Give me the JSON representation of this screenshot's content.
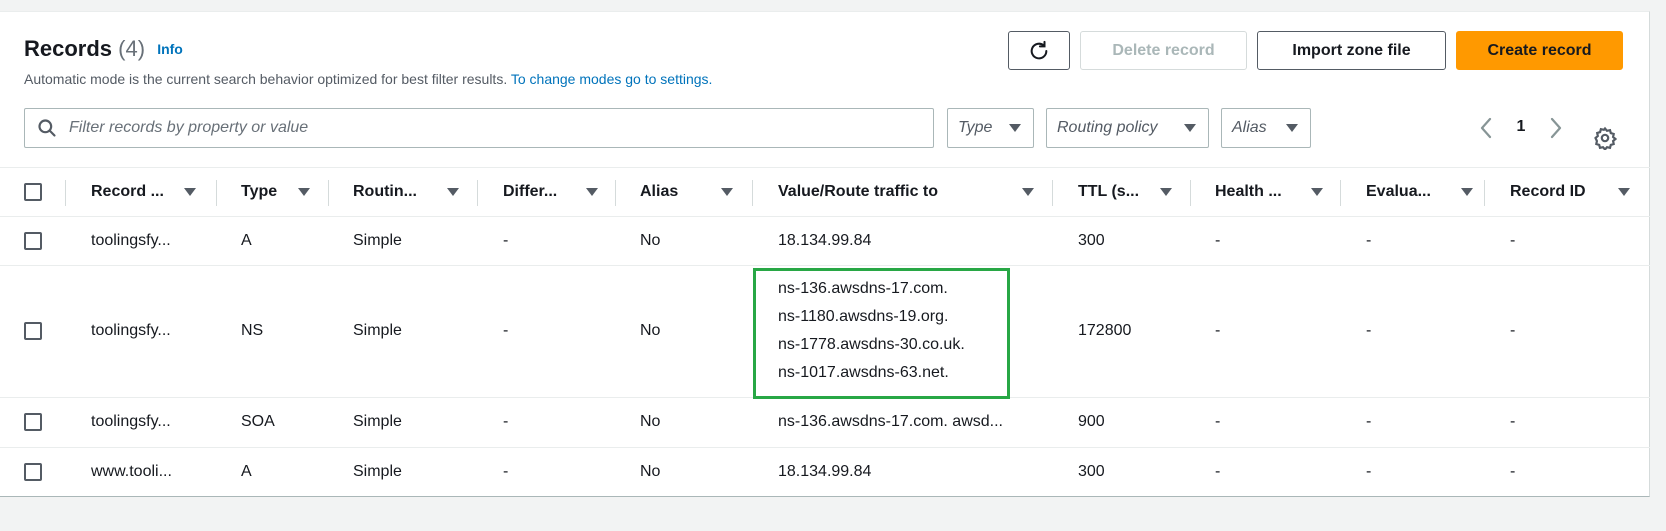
{
  "header": {
    "title": "Records",
    "count": "(4)",
    "info_label": "Info",
    "description": "Automatic mode is the current search behavior optimized for best filter results.",
    "description_link": "To change modes go to settings."
  },
  "toolbar": {
    "refresh_icon": "refresh-icon",
    "delete_label": "Delete record",
    "import_label": "Import zone file",
    "create_label": "Create record"
  },
  "search": {
    "placeholder": "Filter records by property or value",
    "value": ""
  },
  "filters": {
    "type": "Type",
    "routing": "Routing policy",
    "alias": "Alias"
  },
  "pagination": {
    "current_page": "1"
  },
  "table": {
    "columns": [
      "Record ...",
      "Type",
      "Routin...",
      "Differ...",
      "Alias",
      "Value/Route traffic to",
      "TTL (s...",
      "Health ...",
      "Evalua...",
      "Record ID"
    ],
    "rows": [
      {
        "name": "toolingsfy...",
        "type": "A",
        "routing": "Simple",
        "differ": "-",
        "alias": "No",
        "value": [
          "18.134.99.84"
        ],
        "ttl": "300",
        "health": "-",
        "evaluate": "-",
        "record_id": "-"
      },
      {
        "name": "toolingsfy...",
        "type": "NS",
        "routing": "Simple",
        "differ": "-",
        "alias": "No",
        "value": [
          "ns-136.awsdns-17.com.",
          "ns-1180.awsdns-19.org.",
          "ns-1778.awsdns-30.co.uk.",
          "ns-1017.awsdns-63.net."
        ],
        "ttl": "172800",
        "health": "-",
        "evaluate": "-",
        "record_id": "-"
      },
      {
        "name": "toolingsfy...",
        "type": "SOA",
        "routing": "Simple",
        "differ": "-",
        "alias": "No",
        "value": [
          "ns-136.awsdns-17.com. awsd..."
        ],
        "ttl": "900",
        "health": "-",
        "evaluate": "-",
        "record_id": "-"
      },
      {
        "name": "www.tooli...",
        "type": "A",
        "routing": "Simple",
        "differ": "-",
        "alias": "No",
        "value": [
          "18.134.99.84"
        ],
        "ttl": "300",
        "health": "-",
        "evaluate": "-",
        "record_id": "-"
      }
    ]
  },
  "colors": {
    "accent": "#0073bb",
    "primary_button": "#ff9900",
    "highlight_box": "#28a745"
  }
}
